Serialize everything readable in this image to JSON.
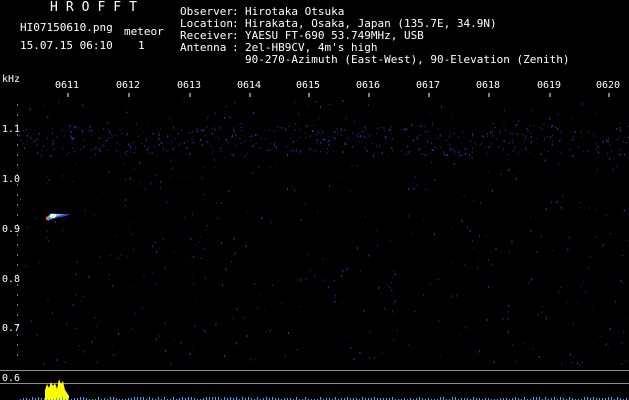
{
  "header": {
    "app_title": "HROFFT",
    "file_name": "HI07150610.png",
    "datetime": "15.07.15 06:10",
    "meteor_label": "meteor",
    "meteor_count": "1",
    "observer_label": "Observer",
    "observer_value": "Hirotaka Otsuka",
    "location_label": "Location",
    "location_value": "Hirakata, Osaka, Japan (135.7E, 34.9N)",
    "receiver_label": "Receiver",
    "receiver_value": "YAESU FT-690 53.749MHz, USB",
    "antenna_label": "Antenna",
    "antenna_value": "2el-HB9CV, 4m's high",
    "antenna_value_2": "90-270-Azimuth (East-West), 90-Elevation (Zenith)",
    "sep": ":"
  },
  "axis": {
    "y_unit": "kHz",
    "time_ticks": [
      "0611",
      "0612",
      "0613",
      "0614",
      "0615",
      "0616",
      "0617",
      "0618",
      "0619",
      "0620"
    ],
    "freq_ticks": [
      "1.1",
      "1.0",
      "0.9",
      "0.8",
      "0.7",
      "0.6"
    ]
  },
  "colors": {
    "background": "#000000",
    "text": "#ffffff",
    "title": "#40c060",
    "noise": "#2030a0",
    "echo": "#80c0ff",
    "level": "#ffff00",
    "level_base": "#20b0ff"
  }
}
